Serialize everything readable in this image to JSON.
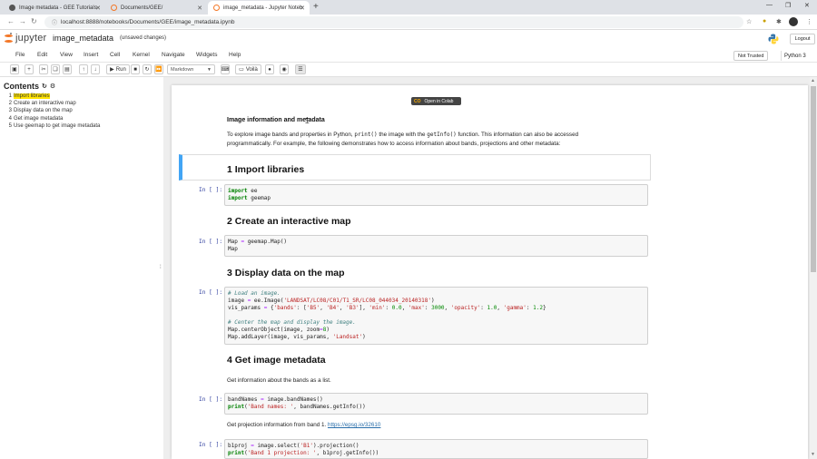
{
  "browser": {
    "tabs": [
      {
        "title": "Image metadata - GEE Tutorials",
        "fav_color": "#555555"
      },
      {
        "title": "Documents/GEE/",
        "fav_color": "#f37726"
      },
      {
        "title": "image_metadata - Jupyter Noteb",
        "fav_color": "#f37726"
      }
    ],
    "new_tab": "+",
    "url": "localhost:8888/notebooks/Documents/GEE/image_metadata.ipynb"
  },
  "jupyter": {
    "logo_text": "jupyter",
    "notebook_title": "image_metadata",
    "save_status": "(unsaved changes)",
    "logout_label": "Logout",
    "trust_label": "Not Trusted",
    "kernel_label": "Python 3",
    "menu": [
      "File",
      "Edit",
      "View",
      "Insert",
      "Cell",
      "Kernel",
      "Navigate",
      "Widgets",
      "Help"
    ],
    "toolbar": {
      "run_label": "Run",
      "cell_type": "Markdown",
      "voila_label": "Voilà"
    }
  },
  "toc": {
    "title": "Contents",
    "items": [
      {
        "num": "1",
        "label": "Import libraries"
      },
      {
        "num": "2",
        "label": "Create an interactive map"
      },
      {
        "num": "3",
        "label": "Display data on the map"
      },
      {
        "num": "4",
        "label": "Get image metadata"
      },
      {
        "num": "5",
        "label": "Use geemap to get image metadata"
      }
    ]
  },
  "notebook": {
    "colab_badge": "Open in Colab",
    "colab_mark": "CO",
    "intro_title": "Image information and metadata",
    "intro_p1_a": "To explore image bands and properties in Python, ",
    "intro_p1_code1": "print()",
    "intro_p1_b": " the image with the ",
    "intro_p1_code2": "getInfo()",
    "intro_p1_c": " function. This information can also be accessed",
    "intro_p2": "programmatically. For example, the following demonstrates how to access information about bands, projections and other metadata:",
    "h1": "1  Import libraries",
    "h2": "2  Create an interactive map",
    "h3": "3  Display data on the map",
    "h4": "4  Get image metadata",
    "prompt": "In [ ]:",
    "p_bands": "Get information about the bands as a list.",
    "p_proj_text": "Get projection information from band 1. ",
    "p_proj_link": "https://epsg.io/32610",
    "code1": [
      "import ee",
      "import geemap"
    ],
    "code2": [
      "Map = geemap.Map()",
      "Map"
    ],
    "code3": [
      "# Load an image.",
      "image = ee.Image('LANDSAT/LC08/C01/T1_SR/LC08_044034_20140318')",
      "vis_params = {'bands': ['B5', 'B4', 'B3'], 'min': 0.0, 'max': 3000, 'opacity': 1.0, 'gamma': 1.2}",
      "",
      "# Center the map and display the image.",
      "Map.centerObject(image, zoom=8)",
      "Map.addLayer(image, vis_params, 'Landsat')"
    ],
    "code4": [
      "bandNames = image.bandNames()",
      "print('Band names: ', bandNames.getInfo())"
    ],
    "code5": [
      "b1proj = image.select('B1').projection()",
      "print('Band 1 projection: ', b1proj.getInfo())"
    ]
  }
}
